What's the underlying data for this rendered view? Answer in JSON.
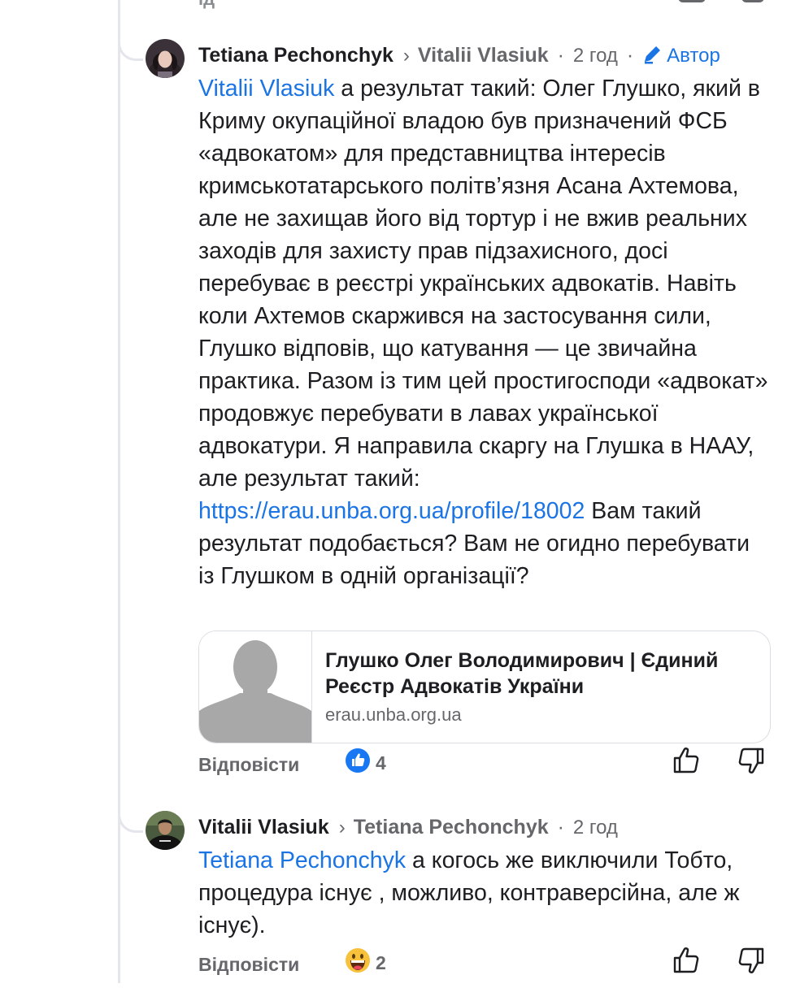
{
  "thread": {
    "previous_fragment": "ід"
  },
  "comments": [
    {
      "author": "Tetiana Pechonchyk",
      "reply_to": "Vitalii Vlasiuk",
      "time": "2 год",
      "author_badge": "Автор",
      "mention": "Vitalii Vlasiuk",
      "text": " а результат такий: Олег Глушко, який в Криму окупаційної владою був призначений ФСБ «адвокатом» для представництва інтересів кримськотатарського політв’язня Асана Ахтемова, але не захищав його від тортур і не вжив реальних заходів для захисту прав підзахисного, досі перебуває в реєстрі українських адвокатів. Навіть коли Ахтемов скаржився на застосування сили, Глушко відповів, що катування — це звичайна практика. Разом із тим цей простигосподи «адвокат» продовжує перебувати в лавах української адвокатури. Я направила скаргу на Глушка в НААУ, але результат такий: ",
      "link": "https://erau.unba.org.ua/profile/18002",
      "text_after": " Вам такий результат подобається? Вам не огидно перебувати із Глушком в одній організації?",
      "preview": {
        "title": "Глушко Олег Володимирович | Єдиний Реєстр Адвокатів України",
        "domain": "erau.unba.org.ua"
      },
      "reply_label": "Відповісти",
      "reaction_icon": "like-icon",
      "reaction_count": "4"
    },
    {
      "author": "Vitalii Vlasiuk",
      "reply_to": "Tetiana Pechonchyk",
      "time": "2 год",
      "mention": "Tetiana Pechonchyk",
      "text": " а когось же виключили Тобто, процедура існує , можливо, контраверсійна, але ж існує).",
      "reply_label": "Відповісти",
      "reaction_icon": "grinning-face-icon",
      "reaction_count": "2"
    }
  ],
  "colors": {
    "link": "#1b74e4",
    "text": "#1c1e21",
    "muted": "#65676b",
    "thread_line": "#e4e6eb"
  }
}
